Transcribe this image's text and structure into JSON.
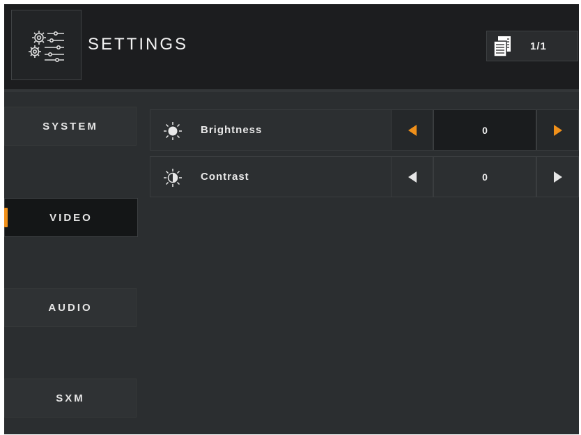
{
  "header": {
    "title": "SETTINGS",
    "page_indicator": "1/1",
    "icons": {
      "logo": "settings-gears-sliders-icon",
      "page": "pages-icon"
    }
  },
  "sidebar": {
    "items": [
      {
        "label": "SYSTEM",
        "active": false
      },
      {
        "label": "VIDEO",
        "active": true
      },
      {
        "label": "AUDIO",
        "active": false
      },
      {
        "label": "SXM",
        "active": false
      }
    ]
  },
  "settings": {
    "rows": [
      {
        "label": "Brightness",
        "value": "0",
        "icon": "brightness-icon",
        "selected": true
      },
      {
        "label": "Contrast",
        "value": "0",
        "icon": "contrast-icon",
        "selected": false
      }
    ]
  },
  "colors": {
    "accent": "#f0901a",
    "background": "#2b2e30",
    "header": "#1c1d1f",
    "active_nav": "#141617"
  }
}
